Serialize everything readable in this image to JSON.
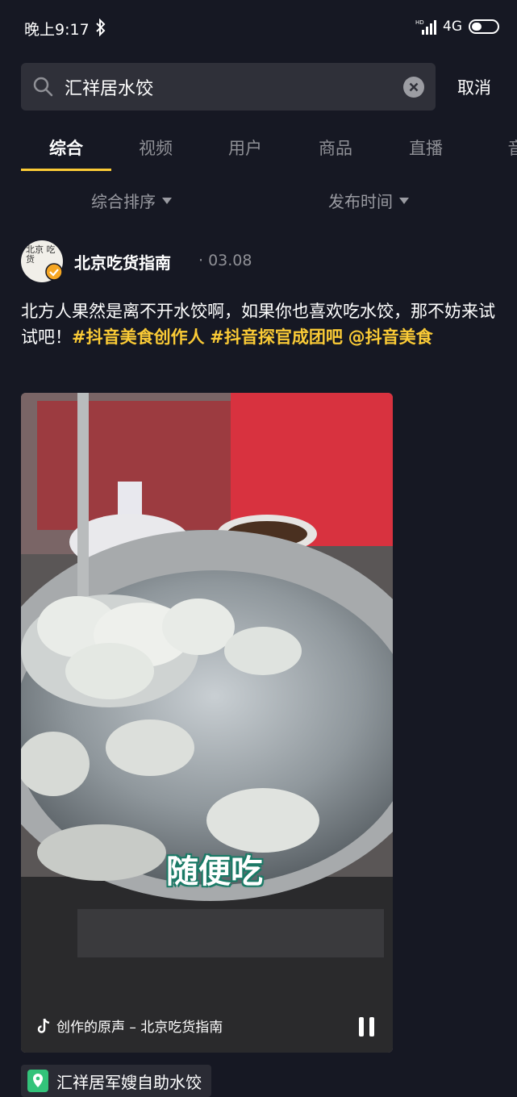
{
  "status": {
    "time": "晚上9:17",
    "network": "4G"
  },
  "search": {
    "query": "汇祥居水饺",
    "cancel_label": "取消"
  },
  "tabs": [
    {
      "label": "综合"
    },
    {
      "label": "视频"
    },
    {
      "label": "用户"
    },
    {
      "label": "商品"
    },
    {
      "label": "直播"
    },
    {
      "label": "音"
    }
  ],
  "filters": {
    "sort_label": "综合排序",
    "time_label": "发布时间"
  },
  "post": {
    "avatar_text": "北京 吃货",
    "author": "北京吃货指南",
    "date": "· 03.08",
    "caption_text": "北方人果然是离不开水饺啊，如果你也喜欢吃水饺，那不妨来试试吧！",
    "hashtag_1": "#抖音美食创作人",
    "hashtag_2": "#抖音探官成团吧",
    "mention": "@抖音美食",
    "video_overlay": "随便吃",
    "music": "创作的原声 – 北京吃货指南",
    "location": "汇祥居军嫂自助水饺"
  },
  "colors": {
    "background": "#161823",
    "accent": "#fbcb36",
    "verified": "#f5a623",
    "location_pin": "#33c37a"
  }
}
